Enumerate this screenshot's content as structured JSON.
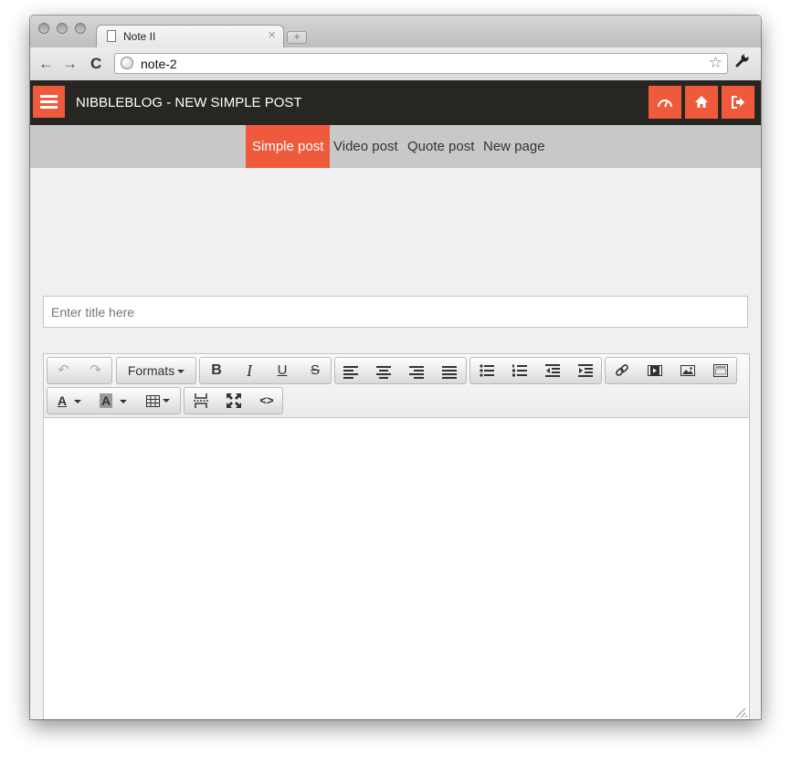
{
  "browser": {
    "tab_title": "Note II",
    "tab_close": "×",
    "new_tab": "+",
    "url": "note-2",
    "back_label": "←",
    "forward_label": "→",
    "reload_label": "C",
    "star_label": "☆",
    "wrench_label": "🔧"
  },
  "app": {
    "title": "NIBBLEBLOG - NEW SIMPLE POST",
    "accent_color": "#f05a3c",
    "bar_color": "#272622",
    "actions": [
      "dashboard-icon",
      "home-icon",
      "logout-icon"
    ]
  },
  "subnav": {
    "items": [
      {
        "label": "Simple post",
        "active": true
      },
      {
        "label": "Video post",
        "active": false
      },
      {
        "label": "Quote post",
        "active": false
      },
      {
        "label": "New page",
        "active": false
      }
    ]
  },
  "form": {
    "title_placeholder": "Enter title here",
    "title_value": ""
  },
  "editor_toolbar": {
    "formats_label": "Formats",
    "bold": "B",
    "italic": "I",
    "underline": "U",
    "strike": "S",
    "text_color": "A",
    "bg_color": "A",
    "code": "<>",
    "undo": "↶",
    "redo": "↷"
  }
}
